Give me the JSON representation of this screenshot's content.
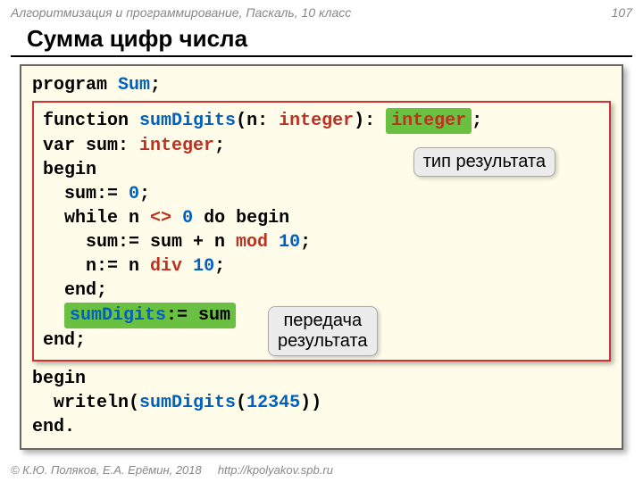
{
  "header": {
    "left": "Алгоритмизация и программирование, Паскаль, 10 класс",
    "page": "107"
  },
  "title": "Сумма цифр числа",
  "code": {
    "l1_program": "program",
    "l1_name": "Sum",
    "l1_semi": ";",
    "fn_kw": "function",
    "fn_name": "sumDigits",
    "fn_paren_open": "(n: ",
    "fn_ptype": "integer",
    "fn_paren_close": "): ",
    "fn_rettype": "integer",
    "fn_semi": ";",
    "var_kw": "var",
    "var_decl": " sum: ",
    "var_type": "integer",
    "var_semi": ";",
    "begin1": "begin",
    "s1": "  sum:= ",
    "s1_zero": "0",
    "s1_semi": ";",
    "s2a": "  while n ",
    "s2_op": "<>",
    "s2b": " ",
    "s2_zero": "0",
    "s2c": " do begin",
    "s3a": "    sum:= sum + n ",
    "s3_mod": "mod",
    "s3b": " ",
    "s3_ten": "10",
    "s3_semi": ";",
    "s4a": "    n:= n ",
    "s4_div": "div",
    "s4b": " ",
    "s4_ten": "10",
    "s4_semi": ";",
    "end1": "  end;",
    "result_lhs": "sumDigits",
    "result_rhs": ":= sum",
    "end2": "end;",
    "main_begin": "begin",
    "main_write": "  writeln(",
    "main_call": "sumDigits",
    "main_open": "(",
    "main_arg": "12345",
    "main_close": "))",
    "main_end": "end."
  },
  "callouts": {
    "c1": "тип результата",
    "c2a": "передача",
    "c2b": "результата"
  },
  "footer": {
    "copyright": "© К.Ю. Поляков, Е.А. Ерёмин, 2018",
    "url": "http://kpolyakov.spb.ru"
  }
}
